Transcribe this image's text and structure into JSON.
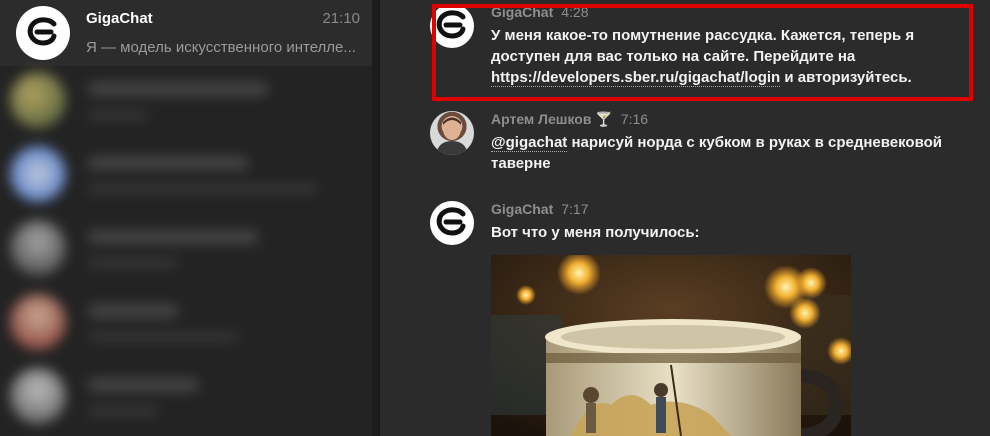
{
  "sidebar": {
    "active_chat": {
      "name": "GigaChat",
      "time": "21:10",
      "preview": "Я — модель искусственного интелле..."
    }
  },
  "messages": [
    {
      "author": "GigaChat",
      "time": "4:28",
      "text_before_link": "У меня какое-то помутнение рассудка. Кажется, теперь я доступен для вас только на сайте. Перейдите на ",
      "link": "https://developers.sber.ru/gigachat/login",
      "text_after_link": " и авторизуйтесь."
    },
    {
      "author": "Артем Лешков",
      "author_badge": "🍸",
      "time": "7:16",
      "mention": "@gigachat",
      "text": " нарисуй норда с кубком в руках в средневековой таверне"
    },
    {
      "author": "GigaChat",
      "time": "7:17",
      "text": "Вот что у меня получилось:"
    }
  ],
  "colors": {
    "highlight": "#e00000",
    "background": "#2b2b2b",
    "sidebar": "#232323"
  }
}
